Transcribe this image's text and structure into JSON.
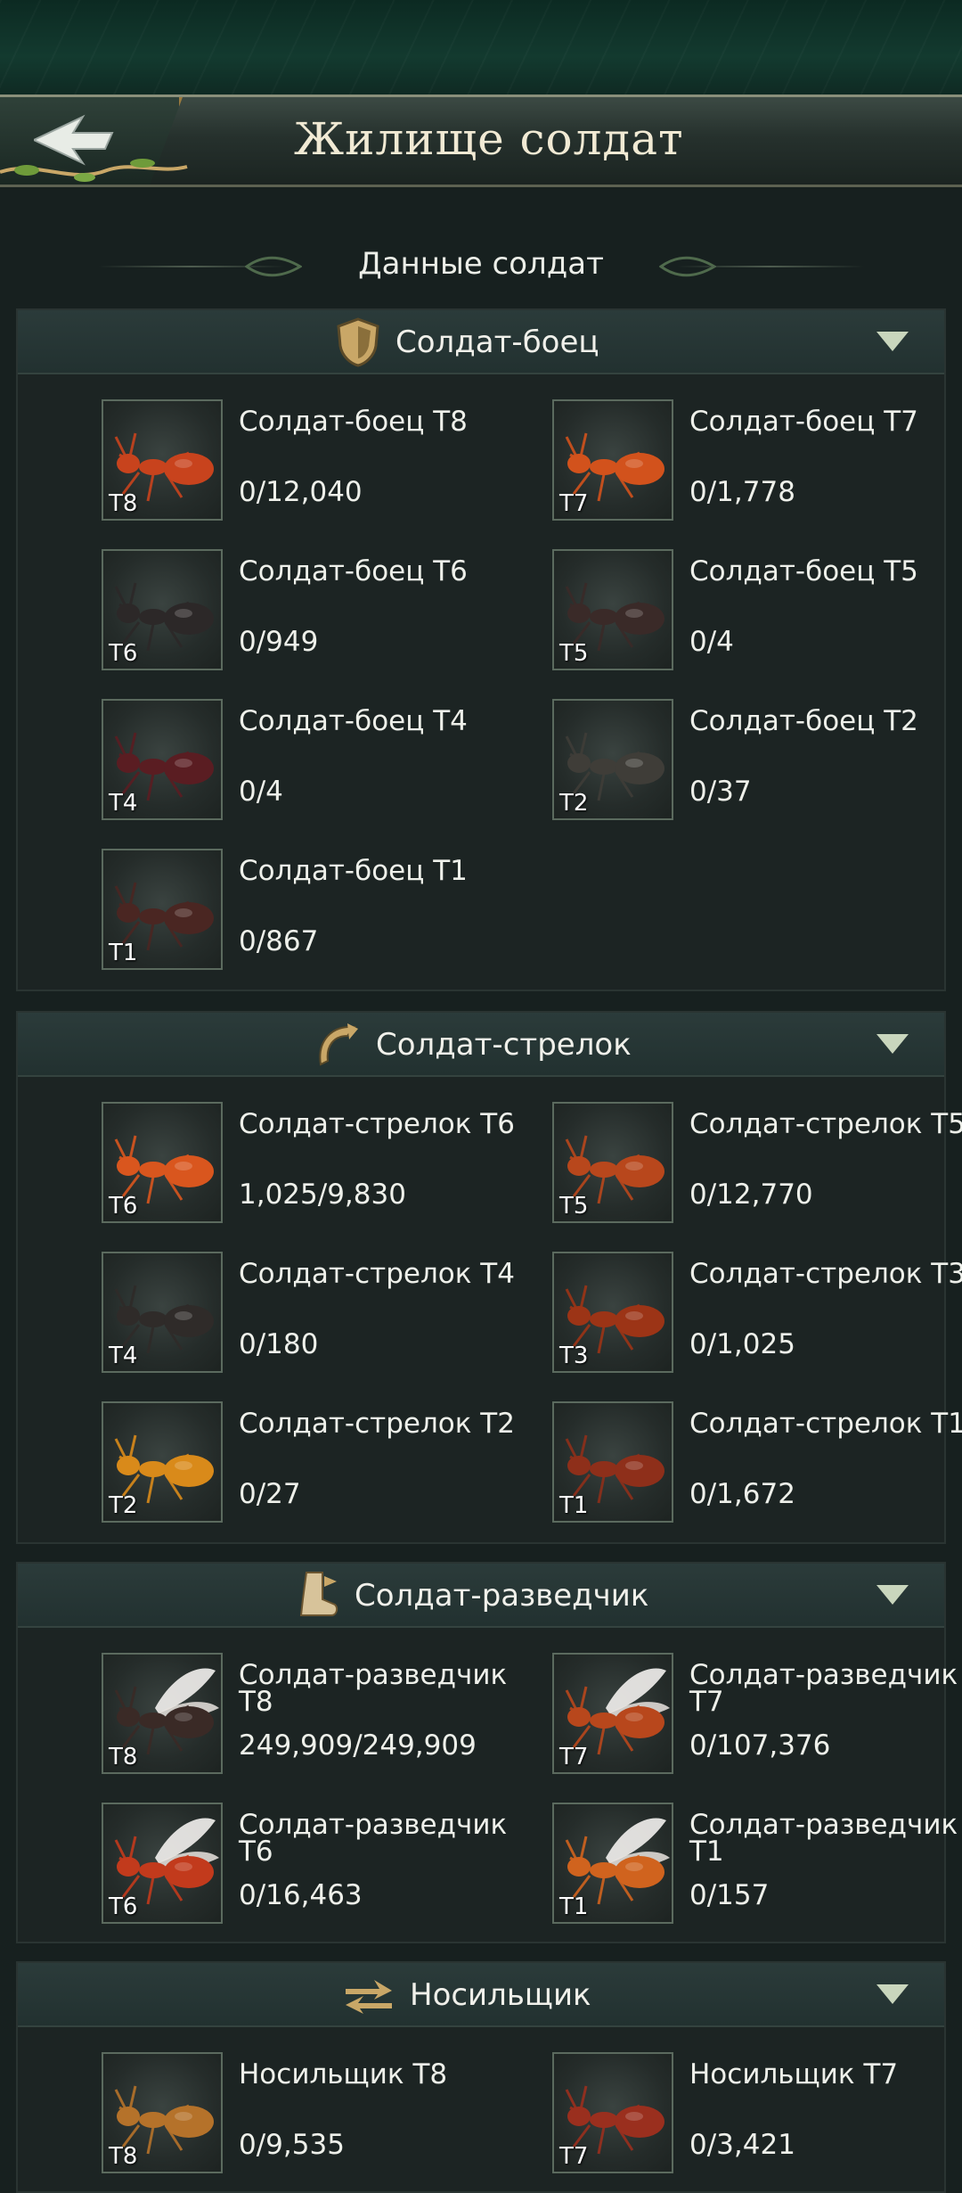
{
  "header": {
    "title": "Жилище солдат"
  },
  "subtitle": "Данные солдат",
  "colors": {
    "background": "#17201f",
    "header_title": "#f1ead4",
    "text": "#eef0ea",
    "accent_gold": "#c9a767",
    "chevron": "#c9d6bd"
  },
  "sections": [
    {
      "title": "Солдат-боец",
      "icon": "shield-icon",
      "units": [
        {
          "name": "Солдат-боец T8",
          "count": "0/12,040",
          "tier": "T8",
          "body": "#c8431d"
        },
        {
          "name": "Солдат-боец T7",
          "count": "0/1,778",
          "tier": "T7",
          "body": "#d2521c"
        },
        {
          "name": "Солдат-боец T6",
          "count": "0/949",
          "tier": "T6",
          "body": "#2c2828"
        },
        {
          "name": "Солдат-боец T5",
          "count": "0/4",
          "tier": "T5",
          "body": "#3a2a28"
        },
        {
          "name": "Солдат-боец T4",
          "count": "0/4",
          "tier": "T4",
          "body": "#5a1d22"
        },
        {
          "name": "Солдат-боец T2",
          "count": "0/37",
          "tier": "T2",
          "body": "#3f3d38"
        },
        {
          "name": "Солдат-боец T1",
          "count": "0/867",
          "tier": "T1",
          "body": "#4a2622"
        }
      ]
    },
    {
      "title": "Солдат-стрелок",
      "icon": "bow-icon",
      "units": [
        {
          "name": "Солдат-стрелок T6",
          "count": "1,025/9,830",
          "tier": "T6",
          "body": "#d9561e"
        },
        {
          "name": "Солдат-стрелок T5",
          "count": "0/12,770",
          "tier": "T5",
          "body": "#b8471c"
        },
        {
          "name": "Солдат-стрелок T4",
          "count": "0/180",
          "tier": "T4",
          "body": "#2f2b29"
        },
        {
          "name": "Солдат-стрелок T3",
          "count": "0/1,025",
          "tier": "T3",
          "body": "#9c3416"
        },
        {
          "name": "Солдат-стрелок T2",
          "count": "0/27",
          "tier": "T2",
          "body": "#d98a1a"
        },
        {
          "name": "Солдат-стрелок T1",
          "count": "0/1,672",
          "tier": "T1",
          "body": "#8e2f1a"
        }
      ]
    },
    {
      "title": "Солдат-разведчик",
      "icon": "boot-icon",
      "units": [
        {
          "name": "Солдат-разведчик T8",
          "count": "249,909/249,909",
          "tier": "T8",
          "body": "#3a2a26",
          "winged": true
        },
        {
          "name": "Солдат-разведчик T7",
          "count": "0/107,376",
          "tier": "T7",
          "body": "#b8471c",
          "winged": true
        },
        {
          "name": "Солдат-разведчик T6",
          "count": "0/16,463",
          "tier": "T6",
          "body": "#c23a1c",
          "winged": true
        },
        {
          "name": "Солдат-разведчик T1",
          "count": "0/157",
          "tier": "T1",
          "body": "#d0631e",
          "winged": true
        }
      ]
    },
    {
      "title": "Носильщик",
      "icon": "carry-arrows-icon",
      "units": [
        {
          "name": "Носильщик T8",
          "count": "0/9,535",
          "tier": "T8",
          "body": "#b5722a"
        },
        {
          "name": "Носильщик T7",
          "count": "0/3,421",
          "tier": "T7",
          "body": "#9a2f1e"
        }
      ]
    }
  ]
}
